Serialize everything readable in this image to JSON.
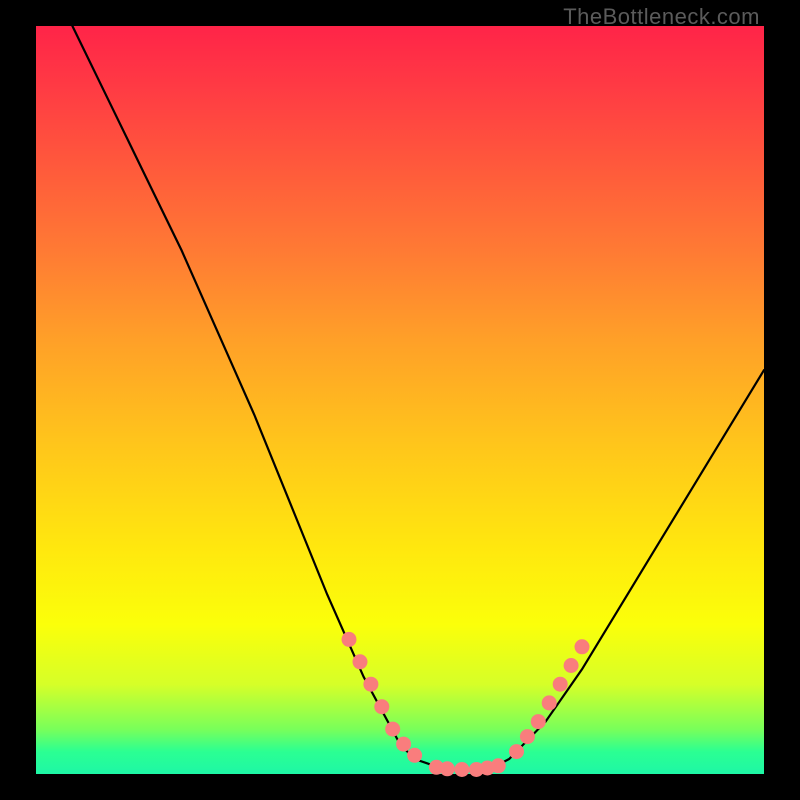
{
  "attribution": "TheBottleneck.com",
  "chart_data": {
    "type": "line",
    "title": "",
    "xlabel": "",
    "ylabel": "",
    "xlim": [
      0,
      100
    ],
    "ylim": [
      0,
      100
    ],
    "series": [
      {
        "name": "bottleneck-curve",
        "x": [
          5,
          10,
          15,
          20,
          25,
          30,
          35,
          40,
          45,
          50,
          52,
          55,
          58,
          60,
          62,
          65,
          70,
          75,
          80,
          85,
          90,
          95,
          100
        ],
        "y": [
          100,
          90,
          80,
          70,
          59,
          48,
          36,
          24,
          13,
          4,
          2,
          1,
          0.5,
          0.5,
          0.5,
          2,
          7,
          14,
          22,
          30,
          38,
          46,
          54
        ]
      }
    ],
    "markers": [
      {
        "name": "left-dots",
        "color": "#f97d7d",
        "points": [
          {
            "x": 43,
            "y": 18
          },
          {
            "x": 44.5,
            "y": 15
          },
          {
            "x": 46,
            "y": 12
          },
          {
            "x": 47.5,
            "y": 9
          },
          {
            "x": 49,
            "y": 6
          },
          {
            "x": 50.5,
            "y": 4
          },
          {
            "x": 52,
            "y": 2.5
          }
        ]
      },
      {
        "name": "bottom-dots",
        "color": "#f97d7d",
        "points": [
          {
            "x": 55,
            "y": 0.9
          },
          {
            "x": 56.5,
            "y": 0.7
          },
          {
            "x": 58.5,
            "y": 0.6
          },
          {
            "x": 60.5,
            "y": 0.6
          },
          {
            "x": 62,
            "y": 0.8
          },
          {
            "x": 63.5,
            "y": 1.1
          }
        ]
      },
      {
        "name": "right-dots",
        "color": "#f97d7d",
        "points": [
          {
            "x": 66,
            "y": 3
          },
          {
            "x": 67.5,
            "y": 5
          },
          {
            "x": 69,
            "y": 7
          },
          {
            "x": 70.5,
            "y": 9.5
          },
          {
            "x": 72,
            "y": 12
          },
          {
            "x": 73.5,
            "y": 14.5
          },
          {
            "x": 75,
            "y": 17
          }
        ]
      }
    ]
  }
}
